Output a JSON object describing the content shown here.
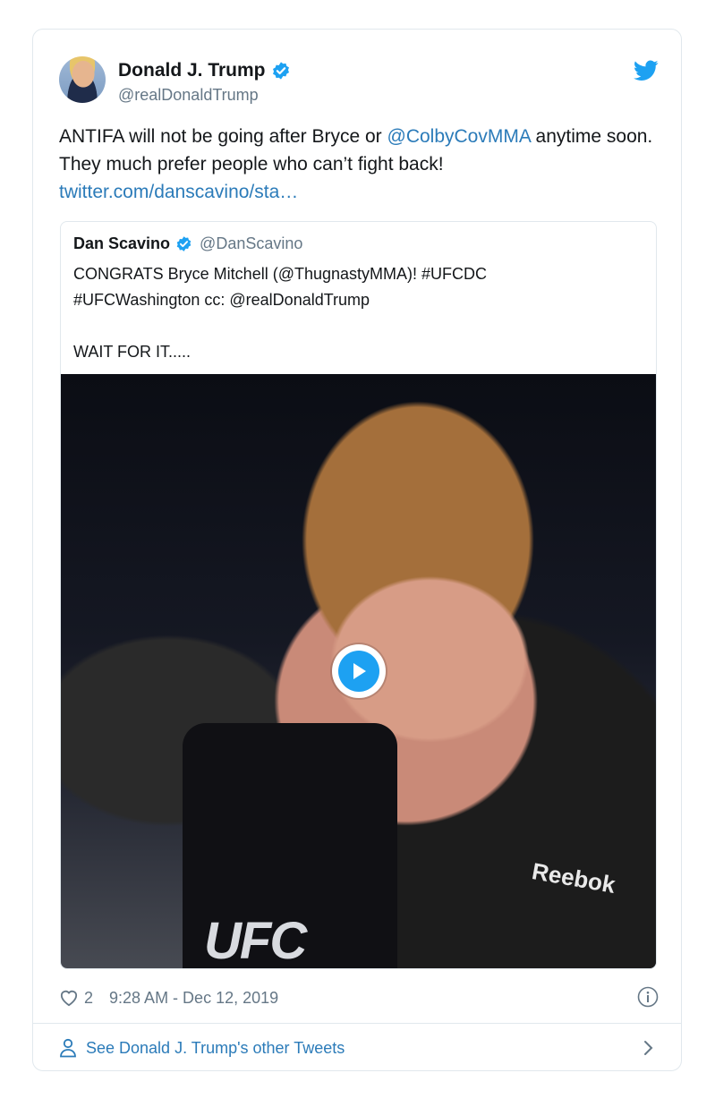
{
  "tweet": {
    "author_name": "Donald J. Trump",
    "author_handle": "@realDonaldTrump",
    "text_part1": "ANTIFA will not be going after Bryce or ",
    "mention": "@ColbyCovMMA",
    "text_part2": " anytime soon. They much prefer people who can’t fight back! ",
    "link": "twitter.com/danscavino/sta…",
    "likes": "2",
    "timestamp": "9:28 AM - Dec 12, 2019"
  },
  "quoted": {
    "author_name": "Dan Scavino",
    "author_handle": "@DanScavino",
    "text": "CONGRATS Bryce Mitchell (@ThugnastyMMA)! #UFCDC\n#UFCWashington cc: @realDonaldTrump\n\nWAIT FOR IT.....",
    "media_mic_logo": "UFC",
    "media_shirt_logo": "Reebok"
  },
  "footer": {
    "label": "See Donald J. Trump's other Tweets"
  },
  "colors": {
    "twitter_blue": "#1da1f2",
    "link": "#2b7bb9",
    "secondary_text": "#657786",
    "border": "#e1e8ed"
  },
  "icons": [
    "twitter-bird-icon",
    "verified-badge-icon",
    "play-icon",
    "heart-icon",
    "info-icon",
    "person-icon",
    "chevron-right-icon"
  ]
}
